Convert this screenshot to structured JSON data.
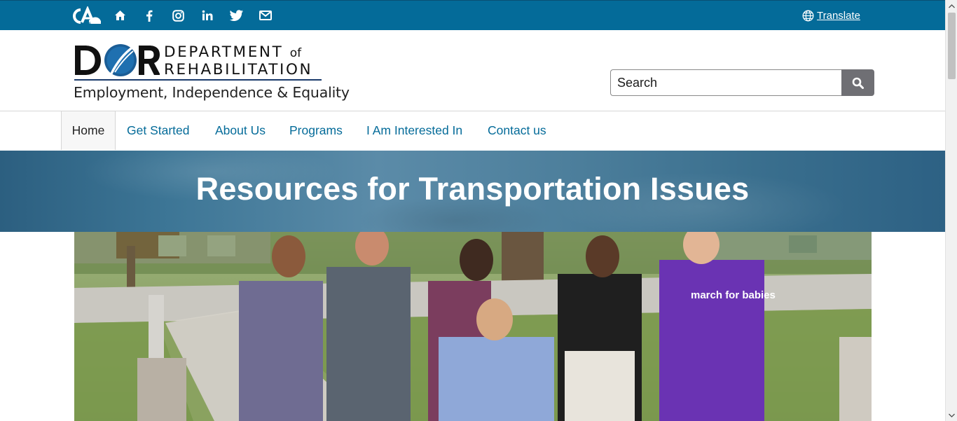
{
  "utility_bar": {
    "ca_logo_text": "CA",
    "social_icons": [
      "home-icon",
      "facebook-icon",
      "instagram-icon",
      "linkedin-icon",
      "twitter-icon",
      "email-icon"
    ],
    "translate_label": "Translate",
    "background_color": "#046b99"
  },
  "logo": {
    "letters": "DOR",
    "department_line1": "DEPARTMENT",
    "department_of": "of",
    "department_line2": "REHABILITATION",
    "tagline": "Employment, Independence & Equality"
  },
  "search": {
    "placeholder": "Search",
    "button_icon": "search-icon"
  },
  "nav": {
    "items": [
      {
        "label": "Home",
        "active": true
      },
      {
        "label": "Get Started",
        "active": false
      },
      {
        "label": "About Us",
        "active": false
      },
      {
        "label": "Programs",
        "active": false
      },
      {
        "label": "I Am Interested In",
        "active": false
      },
      {
        "label": "Contact us",
        "active": false
      }
    ],
    "link_color": "#046b99"
  },
  "banner": {
    "title": "Resources for Transportation Issues"
  },
  "hero": {
    "alt": "march for babies"
  }
}
